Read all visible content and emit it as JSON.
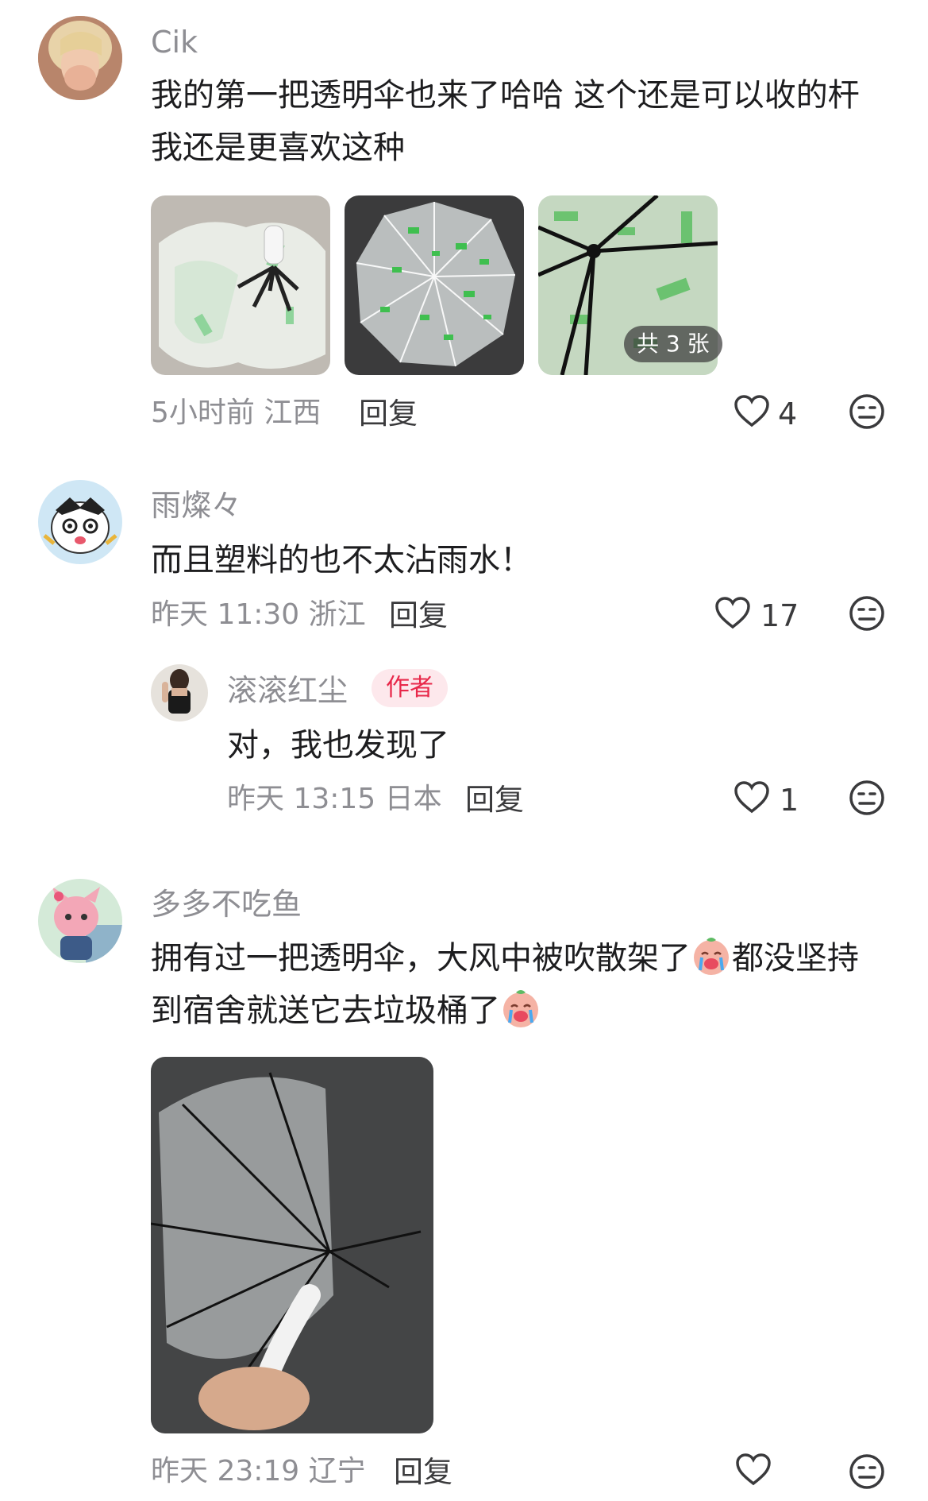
{
  "comments": [
    {
      "username": "Cik",
      "text_line1": "我的第一把透明伞也来了哈哈 这个还是可以收的杆",
      "text_line2": "我还是更喜欢这种",
      "image_count_badge": "共 3 张",
      "meta": "5小时前 江西",
      "reply_label": "回复",
      "likes": "4"
    },
    {
      "username": "雨燦々",
      "text_line1": "而且塑料的也不太沾雨水！",
      "meta": "昨天 11:30 浙江",
      "reply_label": "回复",
      "likes": "17"
    },
    {
      "username": "滚滚红尘",
      "author_tag": "作者",
      "text_line1": "对，我也发现了",
      "meta": "昨天 13:15 日本",
      "reply_label": "回复",
      "likes": "1"
    },
    {
      "username": "多多不吃鱼",
      "text_line1_a": "拥有过一把透明伞，大风中被吹散架了",
      "text_line1_b": "都没坚持",
      "text_line2": "到宿舍就送它去垃圾桶了",
      "meta": "昨天 23:19 辽宁",
      "reply_label": "回复",
      "likes": ""
    }
  ],
  "colors": {
    "author_tag_bg": "#fde8ec",
    "author_tag_text": "#e8284a",
    "meta_text": "#8e8e93"
  },
  "icons": [
    "heart-icon",
    "meh-face-icon",
    "crying-emoji-icon"
  ]
}
